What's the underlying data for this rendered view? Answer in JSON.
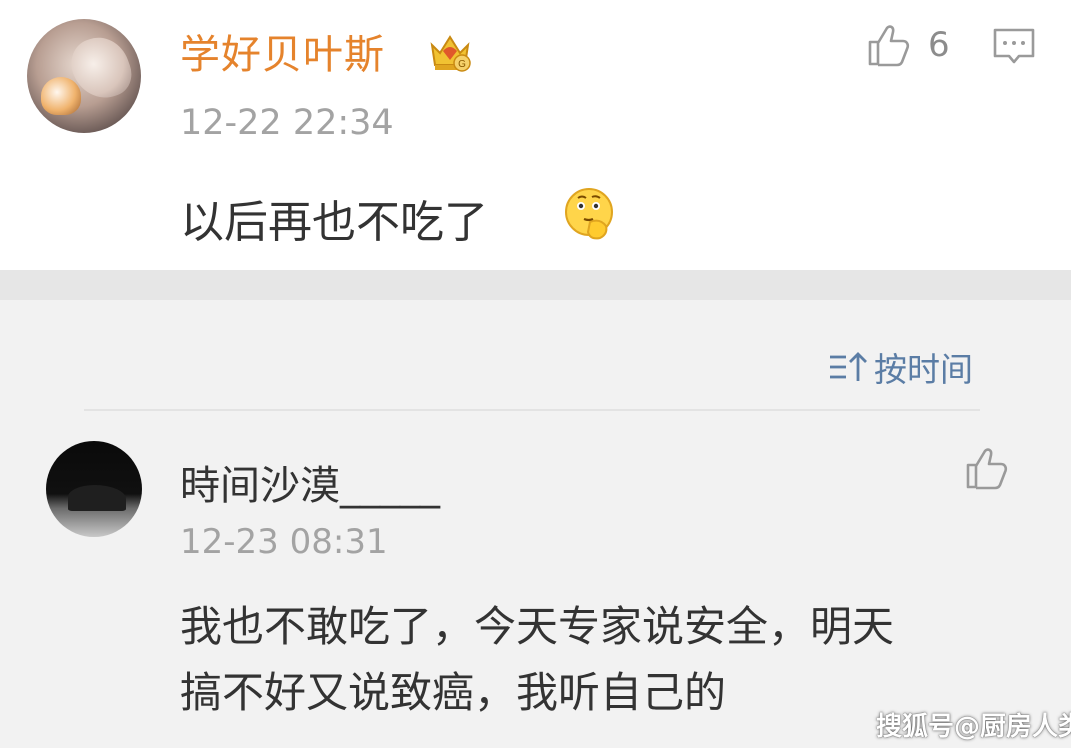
{
  "top_comment": {
    "username": "学好贝叶斯",
    "badge_icon": "crown-icon",
    "timestamp": "12-22 22:34",
    "text": "以后再也不吃了",
    "emoji_icon": "thinking-face-emoji",
    "like_count": "6",
    "like_icon": "thumbs-up-icon",
    "comment_icon": "comment-bubble-icon",
    "username_color": "#e5832c"
  },
  "sort": {
    "label": "按时间",
    "icon": "sort-icon",
    "color": "#5b7da5"
  },
  "replies": [
    {
      "username": "時间沙漠_____",
      "timestamp": "12-23 08:31",
      "text_lines": [
        "我也不敢吃了，今天专家说安全，明天",
        "搞不好又说致癌，我听自己的"
      ],
      "like_icon": "thumbs-up-icon"
    }
  ],
  "watermark": "搜狐号@厨房人类"
}
